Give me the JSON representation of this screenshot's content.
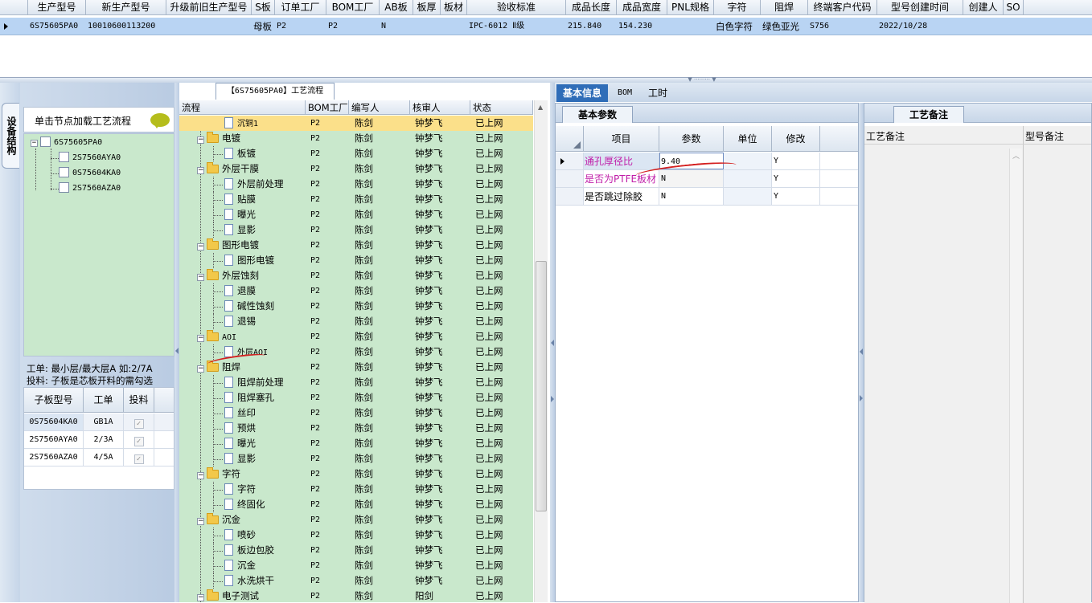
{
  "top_grid": {
    "columns": [
      "生产型号",
      "新生产型号",
      "升级前旧生产型号",
      "S板",
      "订单工厂",
      "BOM工厂",
      "AB板",
      "板厚",
      "板材",
      "验收标准",
      "成品长度",
      "成品宽度",
      "PNL规格",
      "字符",
      "阻焊",
      "终端客户代码",
      "型号创建时间",
      "创建人",
      "SO"
    ],
    "row": [
      "6S75605PA0",
      "10010600113200",
      "",
      "母板",
      "P2",
      "P2",
      "N",
      "",
      "",
      "IPC-6012 Ⅱ级",
      "215.840",
      "154.230",
      "",
      "白色字符",
      "绿色亚光",
      "S756",
      "2022/10/28",
      "",
      ""
    ]
  },
  "left_tab": {
    "label": "设备结构"
  },
  "left_panel": {
    "load_hint": "单击节点加载工艺流程",
    "chat_icon": "speech-bubble-icon",
    "tree": {
      "root": "6S75605PA0",
      "children": [
        "2S7560AYA0",
        "0S75604KA0",
        "2S7560AZA0"
      ]
    },
    "info_line1": "工单: 最小层/最大层A 如:2/7A",
    "info_line2": "投料: 子板是芯板开料的需勾选",
    "sub_grid": {
      "columns": [
        "子板型号",
        "工单",
        "投料"
      ],
      "rows": [
        {
          "model": "0S75604KA0",
          "order": "GB1A",
          "check": "✓"
        },
        {
          "model": "2S7560AYA0",
          "order": "2/3A",
          "check": "✓"
        },
        {
          "model": "2S7560AZA0",
          "order": "4/5A",
          "check": "✓"
        }
      ]
    }
  },
  "process_panel": {
    "tab_title": "【6S75605PA0】工艺流程",
    "columns": [
      "流程",
      "BOM工厂",
      "编写人",
      "核审人",
      "状态"
    ],
    "rows": [
      {
        "level": 2,
        "name": "沉铜1",
        "bom": "P2",
        "writer": "陈剑",
        "reviewer": "钟梦飞",
        "status": "已上网"
      },
      {
        "level": 1,
        "name": "电镀",
        "bom": "P2",
        "writer": "陈剑",
        "reviewer": "钟梦飞",
        "status": "已上网"
      },
      {
        "level": 2,
        "name": "板镀",
        "bom": "P2",
        "writer": "陈剑",
        "reviewer": "钟梦飞",
        "status": "已上网"
      },
      {
        "level": 1,
        "name": "外层干膜",
        "bom": "P2",
        "writer": "陈剑",
        "reviewer": "钟梦飞",
        "status": "已上网"
      },
      {
        "level": 2,
        "name": "外层前处理",
        "bom": "P2",
        "writer": "陈剑",
        "reviewer": "钟梦飞",
        "status": "已上网"
      },
      {
        "level": 2,
        "name": "贴膜",
        "bom": "P2",
        "writer": "陈剑",
        "reviewer": "钟梦飞",
        "status": "已上网"
      },
      {
        "level": 2,
        "name": "曝光",
        "bom": "P2",
        "writer": "陈剑",
        "reviewer": "钟梦飞",
        "status": "已上网"
      },
      {
        "level": 2,
        "name": "显影",
        "bom": "P2",
        "writer": "陈剑",
        "reviewer": "钟梦飞",
        "status": "已上网"
      },
      {
        "level": 1,
        "name": "图形电镀",
        "bom": "P2",
        "writer": "陈剑",
        "reviewer": "钟梦飞",
        "status": "已上网"
      },
      {
        "level": 2,
        "name": "图形电镀",
        "bom": "P2",
        "writer": "陈剑",
        "reviewer": "钟梦飞",
        "status": "已上网"
      },
      {
        "level": 1,
        "name": "外层蚀刻",
        "bom": "P2",
        "writer": "陈剑",
        "reviewer": "钟梦飞",
        "status": "已上网"
      },
      {
        "level": 2,
        "name": "退膜",
        "bom": "P2",
        "writer": "陈剑",
        "reviewer": "钟梦飞",
        "status": "已上网"
      },
      {
        "level": 2,
        "name": "碱性蚀刻",
        "bom": "P2",
        "writer": "陈剑",
        "reviewer": "钟梦飞",
        "status": "已上网"
      },
      {
        "level": 2,
        "name": "退锡",
        "bom": "P2",
        "writer": "陈剑",
        "reviewer": "钟梦飞",
        "status": "已上网"
      },
      {
        "level": 1,
        "name": "AOI",
        "bom": "P2",
        "writer": "陈剑",
        "reviewer": "钟梦飞",
        "status": "已上网"
      },
      {
        "level": 2,
        "name": "外层AOI",
        "bom": "P2",
        "writer": "陈剑",
        "reviewer": "钟梦飞",
        "status": "已上网"
      },
      {
        "level": 1,
        "name": "阻焊",
        "bom": "P2",
        "writer": "陈剑",
        "reviewer": "钟梦飞",
        "status": "已上网"
      },
      {
        "level": 2,
        "name": "阻焊前处理",
        "bom": "P2",
        "writer": "陈剑",
        "reviewer": "钟梦飞",
        "status": "已上网"
      },
      {
        "level": 2,
        "name": "阻焊塞孔",
        "bom": "P2",
        "writer": "陈剑",
        "reviewer": "钟梦飞",
        "status": "已上网"
      },
      {
        "level": 2,
        "name": "丝印",
        "bom": "P2",
        "writer": "陈剑",
        "reviewer": "钟梦飞",
        "status": "已上网"
      },
      {
        "level": 2,
        "name": "预烘",
        "bom": "P2",
        "writer": "陈剑",
        "reviewer": "钟梦飞",
        "status": "已上网"
      },
      {
        "level": 2,
        "name": "曝光",
        "bom": "P2",
        "writer": "陈剑",
        "reviewer": "钟梦飞",
        "status": "已上网"
      },
      {
        "level": 2,
        "name": "显影",
        "bom": "P2",
        "writer": "陈剑",
        "reviewer": "钟梦飞",
        "status": "已上网"
      },
      {
        "level": 1,
        "name": "字符",
        "bom": "P2",
        "writer": "陈剑",
        "reviewer": "钟梦飞",
        "status": "已上网"
      },
      {
        "level": 2,
        "name": "字符",
        "bom": "P2",
        "writer": "陈剑",
        "reviewer": "钟梦飞",
        "status": "已上网"
      },
      {
        "level": 2,
        "name": "终固化",
        "bom": "P2",
        "writer": "陈剑",
        "reviewer": "钟梦飞",
        "status": "已上网"
      },
      {
        "level": 1,
        "name": "沉金",
        "bom": "P2",
        "writer": "陈剑",
        "reviewer": "钟梦飞",
        "status": "已上网"
      },
      {
        "level": 2,
        "name": "喷砂",
        "bom": "P2",
        "writer": "陈剑",
        "reviewer": "钟梦飞",
        "status": "已上网"
      },
      {
        "level": 2,
        "name": "板边包胶",
        "bom": "P2",
        "writer": "陈剑",
        "reviewer": "钟梦飞",
        "status": "已上网"
      },
      {
        "level": 2,
        "name": "沉金",
        "bom": "P2",
        "writer": "陈剑",
        "reviewer": "钟梦飞",
        "status": "已上网"
      },
      {
        "level": 2,
        "name": "水洗烘干",
        "bom": "P2",
        "writer": "陈剑",
        "reviewer": "钟梦飞",
        "status": "已上网"
      },
      {
        "level": 1,
        "name": "电子测试",
        "bom": "P2",
        "writer": "陈剑",
        "reviewer": "阳剑",
        "status": "已上网"
      }
    ]
  },
  "right_tabs": [
    "基本信息",
    "BOM",
    "工时"
  ],
  "basic_params": {
    "tab": "基本参数",
    "columns": [
      "项目",
      "参数",
      "单位",
      "修改"
    ],
    "rows": [
      {
        "item": "通孔厚径比",
        "param": "9.40",
        "unit": "",
        "mod": "Y"
      },
      {
        "item": "是否为PTFE板材",
        "param": "N",
        "unit": "",
        "mod": "Y"
      },
      {
        "item": "是否跳过除胶",
        "param": "N",
        "unit": "",
        "mod": "Y"
      }
    ]
  },
  "notes_panel": {
    "tab": "工艺备注",
    "col1": "工艺备注",
    "col2": "型号备注"
  },
  "colors": {
    "selected_row": "#b9d4f3",
    "tree_bg": "#c9e8cc",
    "highlight_row": "#fbe08a",
    "magenta_text": "#c01ca8",
    "active_tab": "#2f6db8",
    "annotation": "#d42020"
  }
}
